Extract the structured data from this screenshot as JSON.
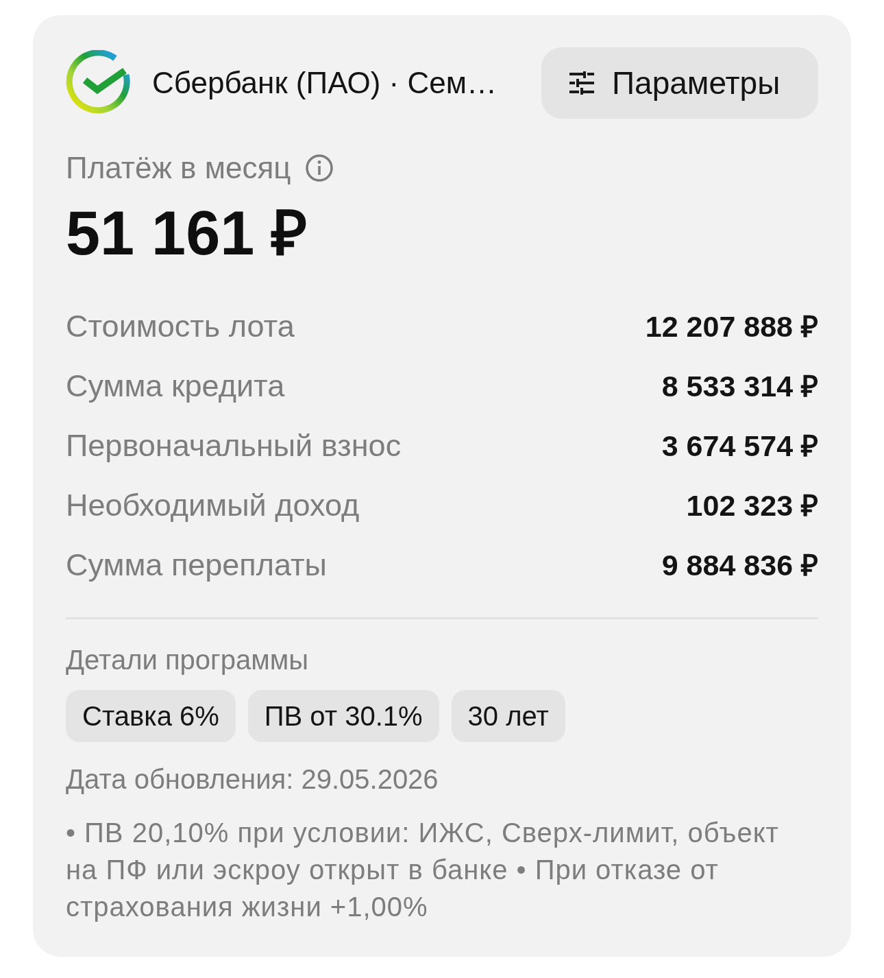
{
  "header": {
    "bank_name": "Сбербанк (ПАО) · Сем…",
    "params_button": "Параметры"
  },
  "payment": {
    "label": "Платёж в месяц",
    "amount": "51 161 ₽"
  },
  "rows": [
    {
      "label": "Стоимость лота",
      "value": "12 207 888 ₽"
    },
    {
      "label": "Сумма кредита",
      "value": "8 533 314 ₽"
    },
    {
      "label": "Первоначальный взнос",
      "value": "3 674 574 ₽"
    },
    {
      "label": "Необходимый доход",
      "value": "102 323 ₽"
    },
    {
      "label": "Сумма переплаты",
      "value": "9 884 836 ₽"
    }
  ],
  "details": {
    "title": "Детали программы",
    "chips": [
      "Ставка 6%",
      "ПВ от 30.1%",
      "30 лет"
    ],
    "updated": "Дата обновления: 29.05.2026",
    "note": "• ПВ 20,10% при условии: ИЖС, Сверх-лимит, объект на ПФ или эскроу открыт в банке • При отказе от страхования жизни +1,00%"
  }
}
